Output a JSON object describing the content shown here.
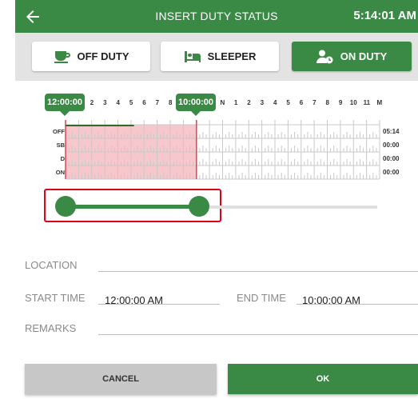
{
  "header": {
    "back_icon": "arrow-left-icon",
    "title": "INSERT DUTY STATUS",
    "clock": "5:14:01 AM"
  },
  "status_buttons": {
    "off_duty": {
      "label": "OFF DUTY",
      "icon": "coffee-cup-icon"
    },
    "sleeper": {
      "label": "SLEEPER",
      "icon": "bed-icon"
    },
    "on_duty": {
      "label": "ON DUTY",
      "icon": "person-clock-icon",
      "selected": true
    }
  },
  "log_grid": {
    "start_tag": "12:00:00",
    "end_tag": "10:00:00",
    "hours_left": [
      "2",
      "3",
      "4",
      "5",
      "6",
      "7",
      "8"
    ],
    "hours_right": [
      "N",
      "1",
      "2",
      "3",
      "4",
      "5",
      "6",
      "7",
      "8",
      "9",
      "10",
      "11",
      "M"
    ],
    "rows": [
      {
        "label": "OFF",
        "total": "05:14"
      },
      {
        "label": "SB",
        "total": "00:00"
      },
      {
        "label": "D",
        "total": "00:00"
      },
      {
        "label": "ON",
        "total": "00:00"
      }
    ],
    "selection_start_hour": 0,
    "selection_end_hour": 10,
    "off_duty_line_end_hour": 5.23,
    "colors": {
      "selection": "#f7c7cc",
      "selection_edge": "#e0434f",
      "line": "#2f6b2a"
    }
  },
  "range_slider": {
    "start_fraction": 0.0,
    "end_fraction": 0.4167
  },
  "form": {
    "location_label": "LOCATION",
    "location_value": "",
    "start_time_label": "START TIME",
    "start_time_value": "12:00:00 AM",
    "end_time_label": "END TIME",
    "end_time_value": "10:00:00 AM",
    "remarks_label": "REMARKS",
    "remarks_value": ""
  },
  "actions": {
    "cancel_label": "CANCEL",
    "ok_label": "OK"
  },
  "colors": {
    "primary": "#3a8a45",
    "alert": "#e0001a"
  }
}
